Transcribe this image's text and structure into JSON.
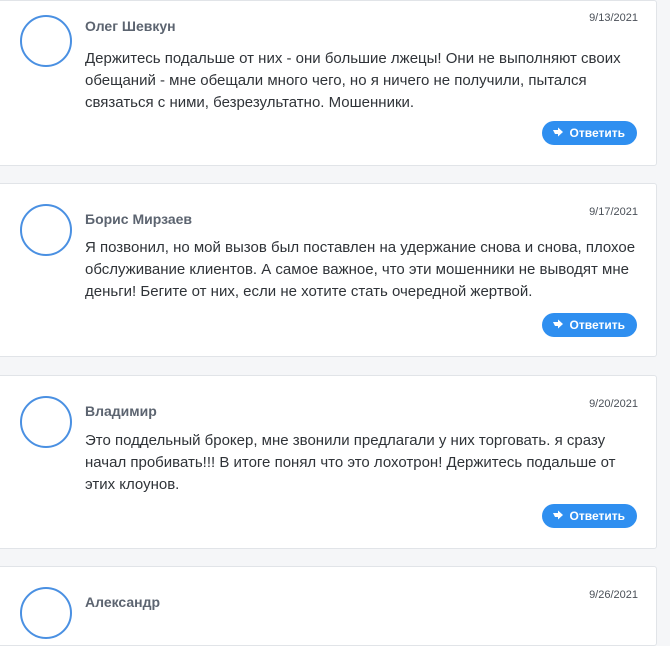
{
  "comments": [
    {
      "author": "Олег Шевкун",
      "date": "9/13/2021",
      "text": "Держитесь подальше от них - они большие лжецы! Они не выполняют своих обещаний - мне обещали много чего, но я ничего не получили, пытался связаться с ними, безрезультатно. Мошенники.",
      "reply_label": "Ответить"
    },
    {
      "author": "Борис Мирзаев",
      "date": "9/17/2021",
      "text": "Я позвонил, но мой вызов был поставлен на удержание снова и снова, плохое обслуживание клиентов. А самое важное, что эти мошенники не выводят мне деньги! Бегите от них, если не хотите стать очередной жертвой.",
      "reply_label": "Ответить"
    },
    {
      "author": "Владимир",
      "date": "9/20/2021",
      "text": "Это поддельный брокер, мне звонили предлагали у них торговать. я сразу начал пробивать!!! В итоге понял что это лохотрон! Держитесь подальше от этих клоунов.",
      "reply_label": "Ответить"
    },
    {
      "author": "Александр",
      "date": "9/26/2021",
      "text": "",
      "reply_label": ""
    }
  ],
  "colors": {
    "accent": "#2f8ff0",
    "avatar_ring": "#4a90e2"
  },
  "icons": {
    "avatar": "avatar-placeholder",
    "reply": "reply-arrow-icon"
  }
}
